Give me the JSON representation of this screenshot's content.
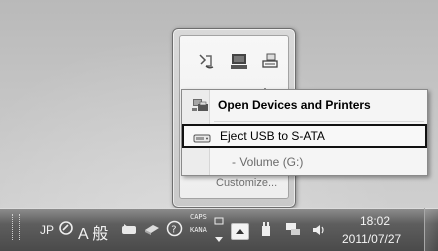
{
  "overflow": {
    "icons": [
      "network-icon",
      "computer-icon",
      "power-icon",
      "camera-icon",
      "folder-icon",
      "flag-icon"
    ],
    "customize_label": "Customize..."
  },
  "context_menu": {
    "items": [
      {
        "label": "Open Devices and Printers",
        "icon": "devices-printers-icon",
        "bold": true
      },
      {
        "label": "Eject USB to S-ATA",
        "icon": "usb-drive-icon",
        "highlighted": true
      },
      {
        "label": "- Volume (G:)",
        "icon": "",
        "disabled": true
      }
    ]
  },
  "taskbar": {
    "language": "JP",
    "ime_mode": "A 般",
    "caps_label": "CAPS",
    "kana_label": "KANA",
    "clock": {
      "time": "18:02",
      "date": "2011/07/27"
    },
    "tray_icons": [
      "ime-pad-icon",
      "ime-mode-icon",
      "tools-icon",
      "dictionary-icon",
      "help-icon",
      "ime-options-icon",
      "show-hidden-icons-icon",
      "safely-remove-hardware-icon",
      "network-icon",
      "volume-icon"
    ]
  }
}
